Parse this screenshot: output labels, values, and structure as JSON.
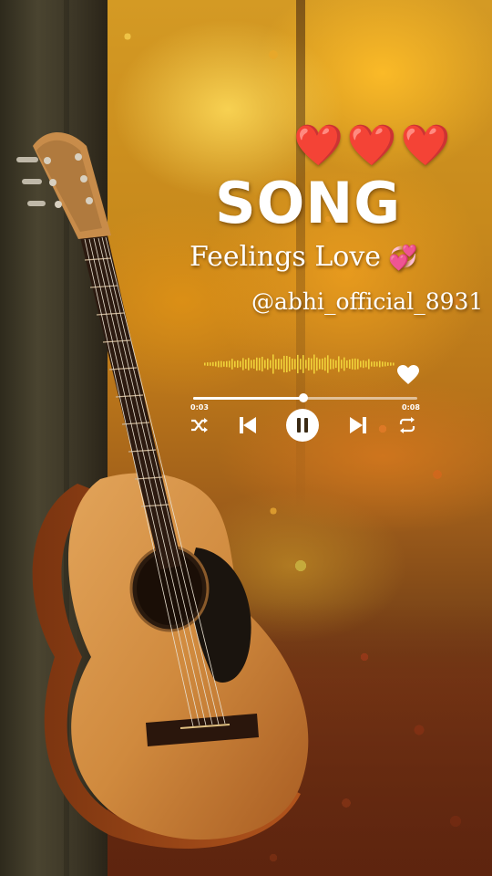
{
  "overlay": {
    "hearts": "❤️❤️❤️",
    "title": "SONG",
    "subtitle": "Feelings Love",
    "subtitle_emoji": "💞",
    "handle": "@abhi_official_8931"
  },
  "player": {
    "elapsed": "0:03",
    "total": "0:08",
    "progress": 0.49,
    "liked": true,
    "controls": {
      "shuffle_icon": "shuffle-icon",
      "previous_icon": "skip-previous-icon",
      "play_pause_icon": "pause-icon",
      "next_icon": "skip-next-icon",
      "repeat_icon": "repeat-icon"
    }
  },
  "colors": {
    "heart": "#e51c24",
    "waveform": "#f0d23a",
    "text": "#ffffff"
  }
}
